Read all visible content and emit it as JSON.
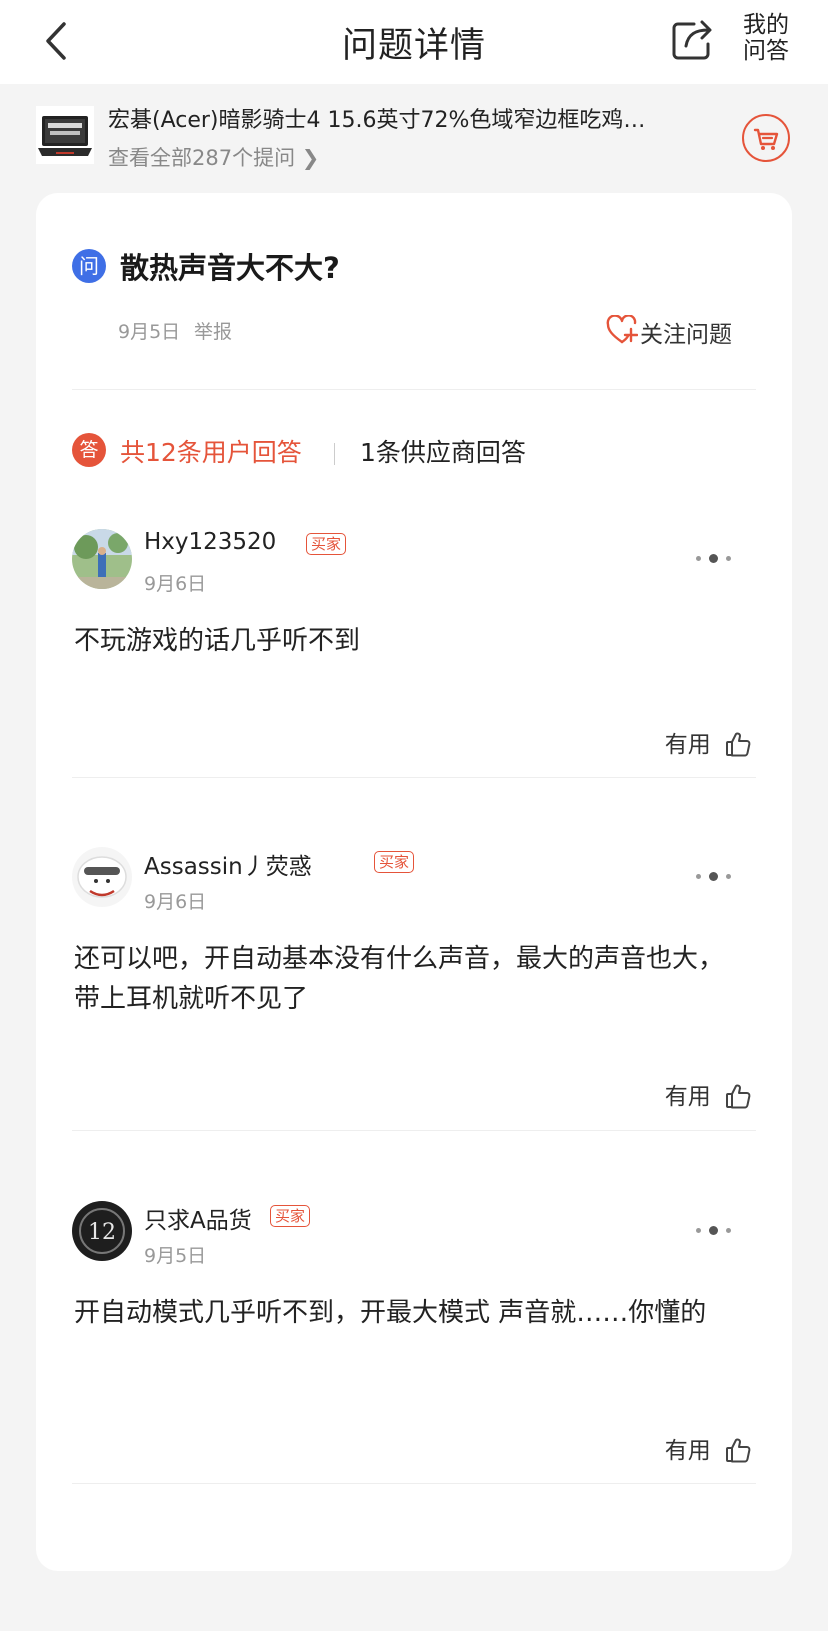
{
  "header": {
    "title": "问题详情",
    "my_qa_line1": "我的",
    "my_qa_line2": "问答"
  },
  "product": {
    "title": "宏碁(Acer)暗影骑士4 15.6英寸72%色域窄边框吃鸡…",
    "view_all": "查看全部287个提问 ❯"
  },
  "question": {
    "icon_text": "问",
    "title": "散热声音大不大?",
    "date": "9月5日",
    "report": "举报",
    "follow_label": "关注问题"
  },
  "tabs": {
    "icon_text": "答",
    "user_answers": "共12条用户回答",
    "vendor_answers": "1条供应商回答"
  },
  "answers": [
    {
      "username": "Hxy123520",
      "badge": "买家",
      "date": "9月6日",
      "content": "不玩游戏的话几乎听不到",
      "useful_label": "有用"
    },
    {
      "username": "Assassin丿荧惑",
      "badge": "买家",
      "date": "9月6日",
      "content": "还可以吧，开自动基本没有什么声音，最大的声音也大，带上耳机就听不见了",
      "useful_label": "有用"
    },
    {
      "username": "只求A品货",
      "badge": "买家",
      "date": "9月5日",
      "content": "开自动模式几乎听不到，开最大模式 声音就……你懂的",
      "useful_label": "有用"
    }
  ],
  "colors": {
    "accent": "#e5543a",
    "question_icon": "#3f6fe6",
    "background": "#f4f4f4"
  },
  "icons": [
    "back-arrow-icon",
    "share-icon",
    "cart-icon",
    "heart-plus-icon",
    "more-dots-icon",
    "thumb-up-icon"
  ]
}
